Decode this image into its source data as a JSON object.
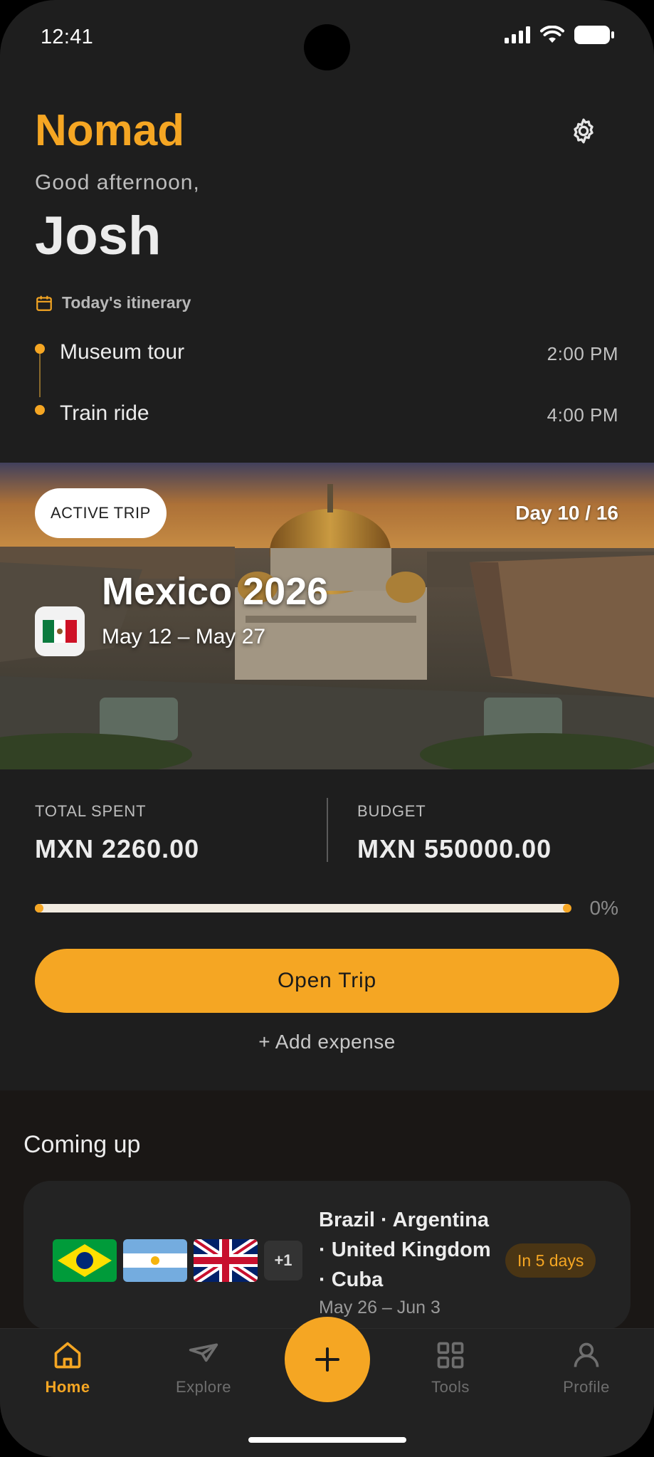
{
  "status_bar": {
    "time": "12:41"
  },
  "header": {
    "brand": "Nomad",
    "greeting": "Good afternoon,",
    "user_name": "Josh"
  },
  "itinerary": {
    "heading": "Today's itinerary",
    "items": [
      {
        "title": "Museum tour",
        "time": "2:00 PM"
      },
      {
        "title": "Train ride",
        "time": "4:00 PM"
      }
    ]
  },
  "active_trip": {
    "pill": "ACTIVE TRIP",
    "day_progress": "Day 10 / 16",
    "title": "Mexico 2026",
    "dates": "May 12 – May 27",
    "flag": "mexico-flag"
  },
  "stats": {
    "total_spent_label": "TOTAL SPENT",
    "total_spent_value": "MXN 2260.00",
    "budget_label": "BUDGET",
    "budget_value": "MXN 550000.00",
    "progress_percent_label": "0%",
    "progress_fraction": 0.0041
  },
  "actions": {
    "open_trip": "Open Trip",
    "add_expense": "+ Add expense"
  },
  "coming_up": {
    "title": "Coming up",
    "trip": {
      "flags": [
        "brazil-flag",
        "argentina-flag",
        "uk-flag"
      ],
      "more_count": "+1",
      "countries": "Brazil · Argentina · United Kingdom · Cuba",
      "dates": "May 26 – Jun 3",
      "badge": "In 5 days"
    }
  },
  "tabbar": {
    "tabs": [
      {
        "label": "Home",
        "icon": "home-icon",
        "active": true
      },
      {
        "label": "Explore",
        "icon": "paper-plane-icon",
        "active": false
      },
      {
        "label": "Tools",
        "icon": "grid-icon",
        "active": false
      },
      {
        "label": "Profile",
        "icon": "person-icon",
        "active": false
      }
    ],
    "fab_icon": "plus-icon"
  },
  "colors": {
    "accent": "#f5a623",
    "background": "#1e1e1e",
    "card": "#232323",
    "badge_bg": "#4a3514"
  }
}
